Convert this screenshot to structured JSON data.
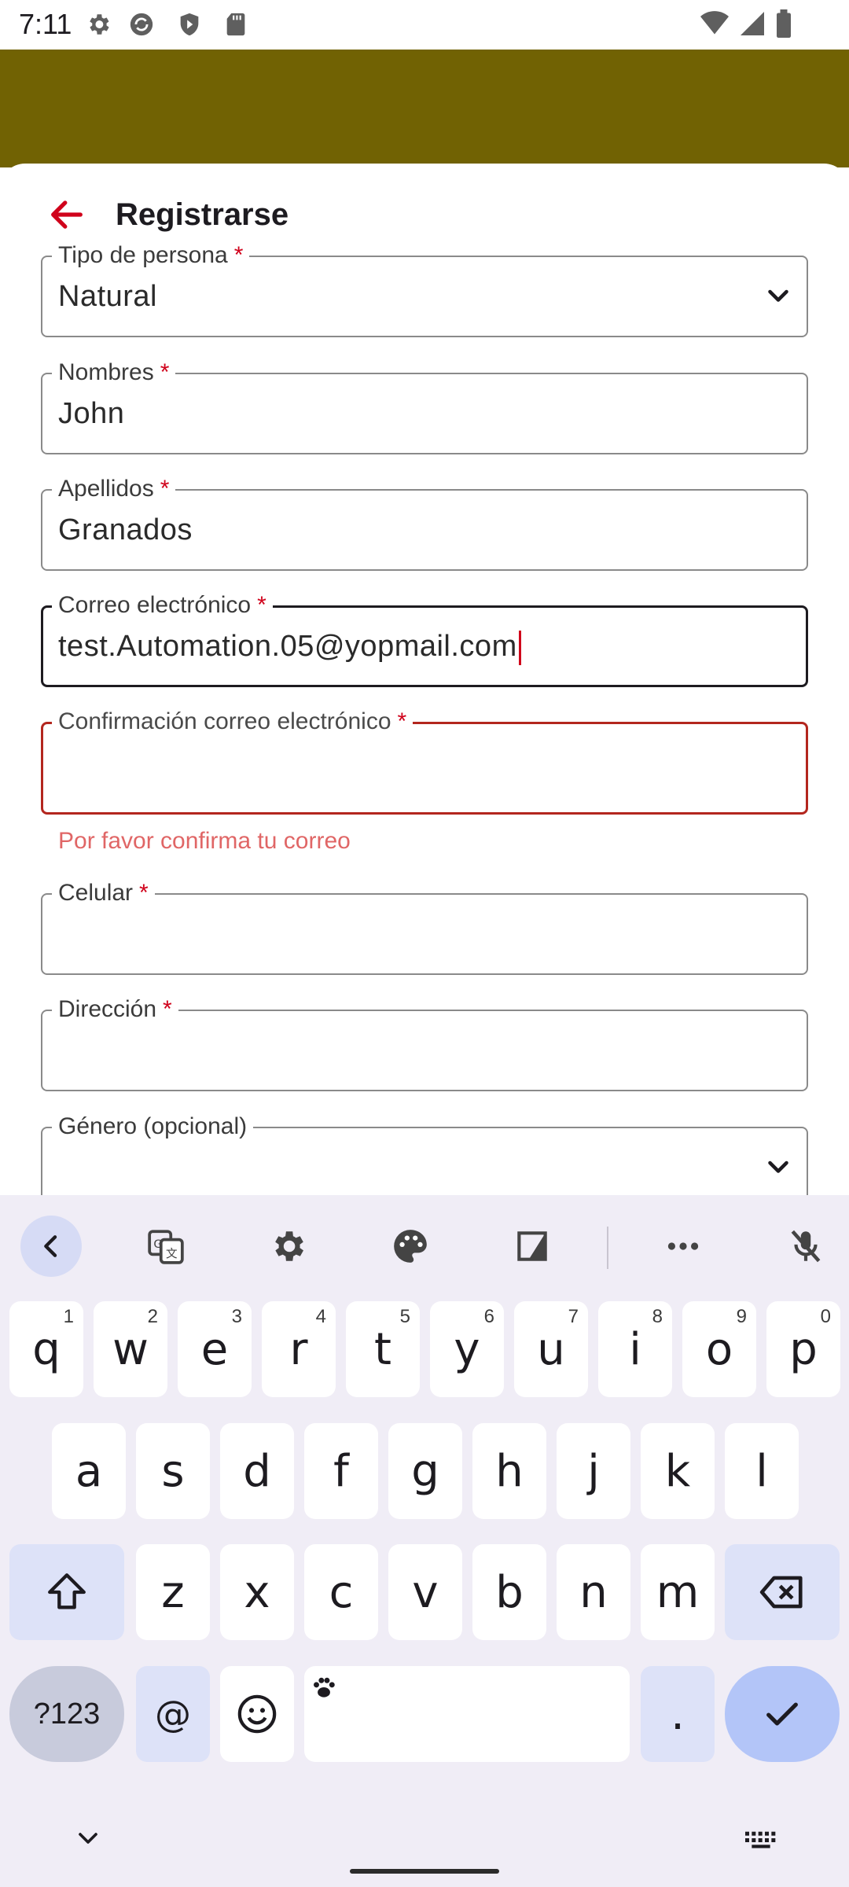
{
  "status_bar": {
    "time": "7:11",
    "icons_left": [
      "gear-icon",
      "sync-icon",
      "shield-play-icon",
      "sd-card-icon"
    ],
    "icons_right": [
      "wifi-icon",
      "signal-icon",
      "battery-icon"
    ]
  },
  "colors": {
    "header": "#716203",
    "accent_red": "#d0021b",
    "error": "#b3261e",
    "keyboard_bg": "#f0edf6"
  },
  "header": {
    "title": "Registrarse",
    "back_icon": "arrow-left-icon"
  },
  "form": {
    "tipo": {
      "label": "Tipo de persona",
      "required": "*",
      "value": "Natural"
    },
    "nombres": {
      "label": "Nombres",
      "required": "*",
      "value": "John"
    },
    "apellidos": {
      "label": "Apellidos",
      "required": "*",
      "value": "Granados"
    },
    "correo": {
      "label": "Correo electrónico",
      "required": "*",
      "value": "test.Automation.05@yopmail.com"
    },
    "confirmacion": {
      "label": "Confirmación correo electrónico",
      "required": "*",
      "value": "",
      "error": "Por favor confirma tu correo"
    },
    "celular": {
      "label": "Celular",
      "required": "*",
      "value": ""
    },
    "direccion": {
      "label": "Dirección",
      "required": "*",
      "value": ""
    },
    "genero": {
      "label": "Género (opcional)",
      "value": ""
    }
  },
  "keyboard": {
    "toolbar": [
      "chevron-left-icon",
      "translate-icon",
      "settings-icon",
      "palette-icon",
      "floating-keyboard-icon",
      "more-icon",
      "mic-off-icon"
    ],
    "row1": [
      {
        "k": "q",
        "h": "1"
      },
      {
        "k": "w",
        "h": "2"
      },
      {
        "k": "e",
        "h": "3"
      },
      {
        "k": "r",
        "h": "4"
      },
      {
        "k": "t",
        "h": "5"
      },
      {
        "k": "y",
        "h": "6"
      },
      {
        "k": "u",
        "h": "7"
      },
      {
        "k": "i",
        "h": "8"
      },
      {
        "k": "o",
        "h": "9"
      },
      {
        "k": "p",
        "h": "0"
      }
    ],
    "row2": [
      "a",
      "s",
      "d",
      "f",
      "g",
      "h",
      "j",
      "k",
      "l"
    ],
    "row3": [
      "z",
      "x",
      "c",
      "v",
      "b",
      "n",
      "m"
    ],
    "sym_key": "?123",
    "at_key": "@",
    "period_key": "."
  }
}
